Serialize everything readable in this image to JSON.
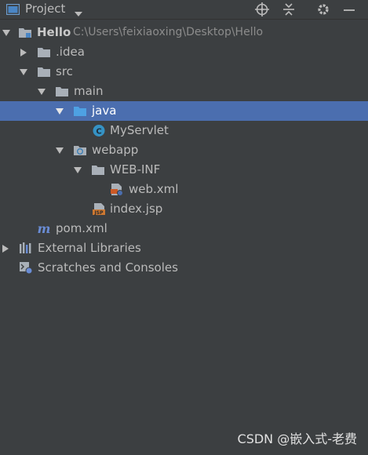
{
  "header": {
    "title": "Project",
    "icons": [
      "project-icon",
      "dropdown-icon",
      "locate-icon",
      "collapse-all-icon",
      "gear-icon",
      "minimize-icon"
    ]
  },
  "tree": {
    "root": {
      "label": "Hello",
      "path": "C:\\Users\\feixiaoxing\\Desktop\\Hello"
    },
    "idea": "idea",
    "src": "src",
    "main": "main",
    "java": "java",
    "myservlet": "MyServlet",
    "webapp": "webapp",
    "webinf": "WEB-INF",
    "webxml": "web.xml",
    "indexjsp": "index.jsp",
    "pomxml": "pom.xml",
    "extlibs": "External Libraries",
    "scratches": "Scratches and Consoles"
  },
  "watermark": "CSDN @嵌入式-老费",
  "colors": {
    "background": "#3c3f41",
    "selection": "#4b6eaf",
    "folder": "#a9b0b8",
    "java_folder": "#4b9bd8",
    "class_icon": "#3592c4",
    "maven": "#6a8dd6",
    "jsp_icon": "#cc7832"
  }
}
